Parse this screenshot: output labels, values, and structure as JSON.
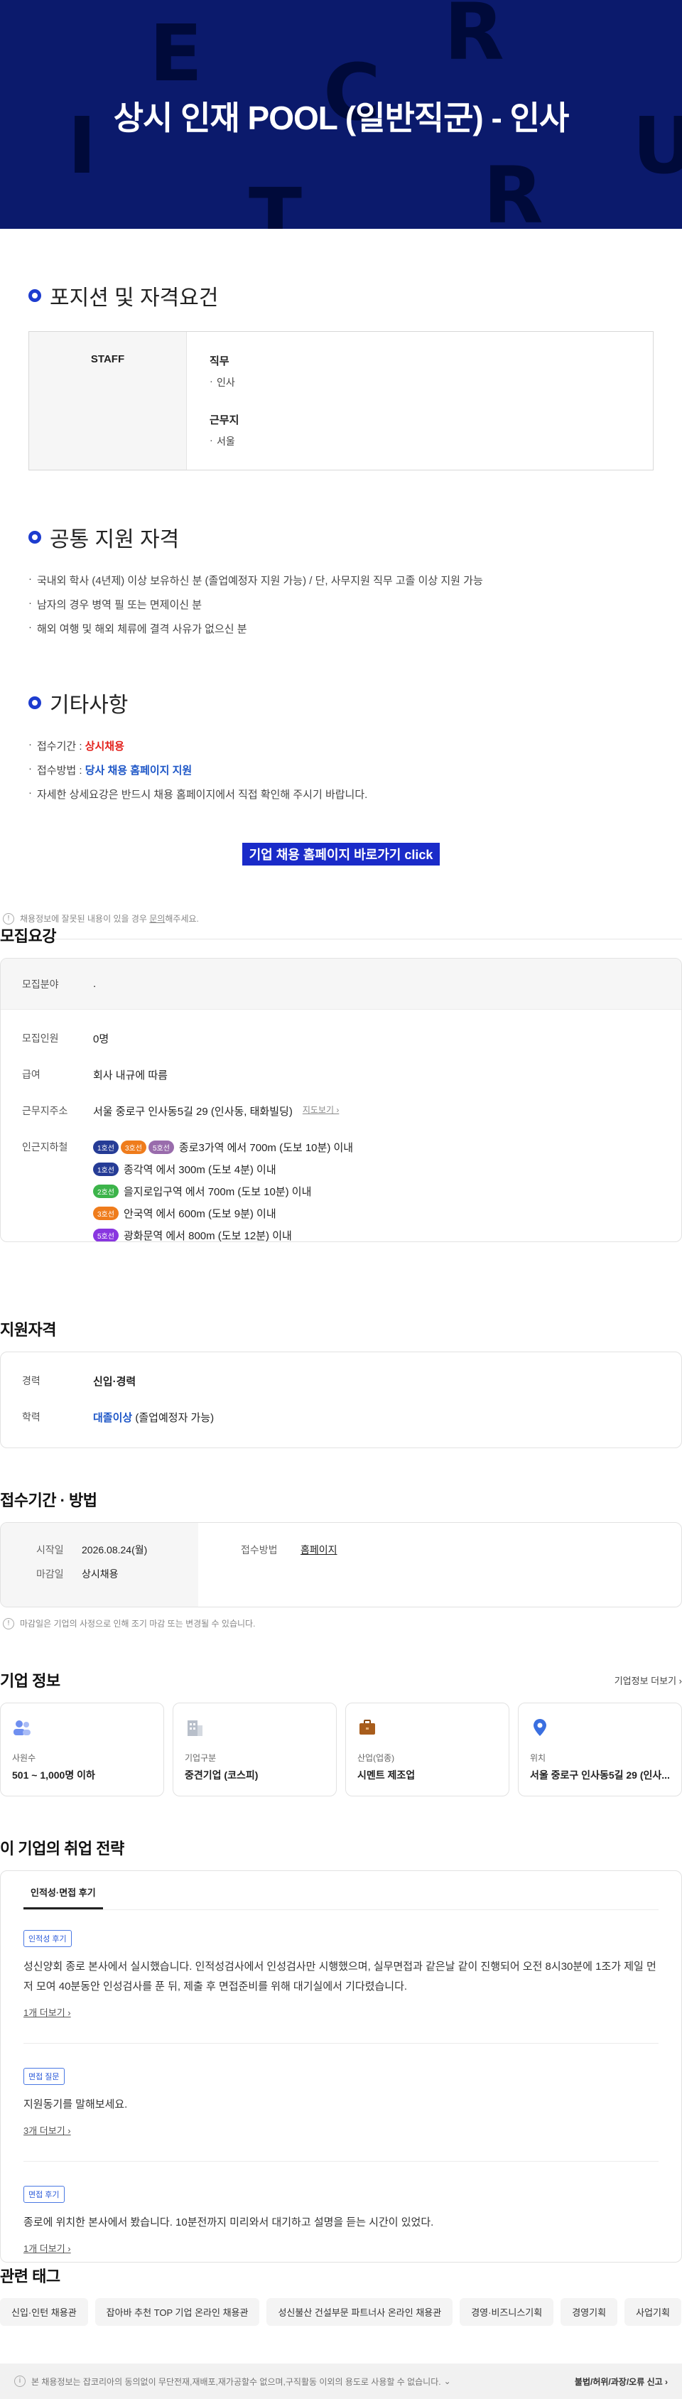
{
  "hero": {
    "title": "상시 인재 POOL (일반직군) - 인사",
    "deco_letters": [
      "E",
      "R",
      "C",
      "U",
      "I",
      "T",
      "R"
    ]
  },
  "posting": {
    "position_title": "포지션 및 자격요건",
    "position_row": {
      "name": "STAFF",
      "duty_label": "직무",
      "duty_value": "인사",
      "location_label": "근무지",
      "location_value": "서울"
    },
    "common_title": "공통 지원 자격",
    "common_items": [
      "국내외 학사 (4년제) 이상 보유하신 분 (졸업예정자 지원 가능) / 단, 사무지원 직무 고졸 이상 지원 가능",
      "남자의 경우 병역 필 또는 면제이신 분",
      "해외 여행 및 해외 체류에 결격 사유가 없으신 분"
    ],
    "etc_title": "기타사항",
    "etc_period_label": "접수기간 : ",
    "etc_period_value": "상시채용",
    "etc_method_label": "접수방법 : ",
    "etc_method_value": "당사 채용 홈페이지 지원",
    "etc_note": "자세한 상세요강은 반드시 채용 홈페이지에서 직접 확인해 주시기 바랍니다.",
    "cta_label": "기업 채용 홈페이지 바로가기 click"
  },
  "notice": {
    "before": "채용정보에 잘못된 내용이 있을 경우 ",
    "link": "문의",
    "after": "해주세요."
  },
  "recruit": {
    "title": "모집요강",
    "field_label": "모집분야",
    "field_value": ".",
    "headcount_label": "모집인원",
    "headcount_value": "0명",
    "salary_label": "급여",
    "salary_value": "회사 내규에 따름",
    "address_label": "근무지주소",
    "address_value": "서울 중로구 인사동5길 29 (인사동, 태화빌딩)",
    "map_link": "지도보기",
    "subway_label": "인근지하철",
    "subway": [
      {
        "lines": [
          {
            "name": "1호선",
            "color": "#263c96"
          },
          {
            "name": "3호선",
            "color": "#ef7c1c"
          },
          {
            "name": "5호선",
            "color": "#996cac"
          }
        ],
        "text": "종로3가역 에서 700m (도보 10분) 이내"
      },
      {
        "lines": [
          {
            "name": "1호선",
            "color": "#263c96"
          }
        ],
        "text": "종각역 에서 300m (도보 4분) 이내"
      },
      {
        "lines": [
          {
            "name": "2호선",
            "color": "#3cb44a"
          }
        ],
        "text": "을지로입구역 에서 700m (도보 10분) 이내"
      },
      {
        "lines": [
          {
            "name": "3호선",
            "color": "#ef7c1c"
          }
        ],
        "text": "안국역 에서 600m (도보 9분) 이내"
      },
      {
        "lines": [
          {
            "name": "5호선",
            "color": "#8936e0"
          }
        ],
        "text": "광화문역 에서 800m (도보 12분) 이내"
      }
    ]
  },
  "qualification": {
    "title": "지원자격",
    "career_label": "경력",
    "career_value": "신입·경력",
    "edu_label": "학력",
    "edu_value": "대졸이상",
    "edu_note": " (졸업예정자 가능)"
  },
  "apply": {
    "title": "접수기간 · 방법",
    "start_label": "시작일",
    "start_value": "2026.08.24(월)",
    "end_label": "마감일",
    "end_value": "상시채용",
    "method_label": "접수방법",
    "method_value": "홈페이지",
    "note": "마감일은 기업의 사정으로 인해 조기 마감 또는 변경될 수 있습니다."
  },
  "company": {
    "title": "기업 정보",
    "more": "기업정보 더보기",
    "cards": [
      {
        "icon": "people-icon",
        "label": "사원수",
        "value": "501 ~ 1,000명 이하"
      },
      {
        "icon": "building-icon",
        "label": "기업구분",
        "value": "중견기업 (코스피)"
      },
      {
        "icon": "briefcase-icon",
        "label": "산업(업종)",
        "value": "시멘트 제조업"
      },
      {
        "icon": "pin-icon",
        "label": "위치",
        "value": "서울 중로구 인사동5길 29 (인사..."
      }
    ]
  },
  "strategy": {
    "title": "이 기업의 취업 전략",
    "tab": "인적성·면접 후기",
    "items": [
      {
        "tag": "인적성 후기",
        "text": "성신양회 종로 본사에서 실시했습니다. 인적성검사에서 인성검사만 시행했으며, 실무면접과 같은날 같이 진행되어 오전 8시30분에 1조가 제일 먼저 모여 40분동안 인성검사를 푼 뒤, 제출 후 면접준비를 위해 대기실에서 기다렸습니다.",
        "more": "1개 더보기"
      },
      {
        "tag": "면접 질문",
        "text": "지원동기를 말해보세요.",
        "more": "3개 더보기"
      },
      {
        "tag": "면접 후기",
        "text": "종로에 위치한 본사에서 봤습니다. 10분전까지 미리와서 대기하고 설명을 듣는 시간이 있었다.",
        "more": "1개 더보기"
      }
    ]
  },
  "tags": {
    "title": "관련 태그",
    "items": [
      "신입·인턴 채용관",
      "잡아바 추천 TOP 기업 온라인 채용관",
      "성신불산 건설부문 파트너사 온라인 채용관",
      "경영·비즈니스기획",
      "경영기획",
      "사업기획"
    ]
  },
  "footer": {
    "text": "본 채용정보는 잡코리아의 동의없이 무단전재,재배포,재가공할수 없으며,구직활동 이외의 용도로 사용할 수 없습니다.",
    "report": "불법/허위/과장/오류 신고"
  }
}
